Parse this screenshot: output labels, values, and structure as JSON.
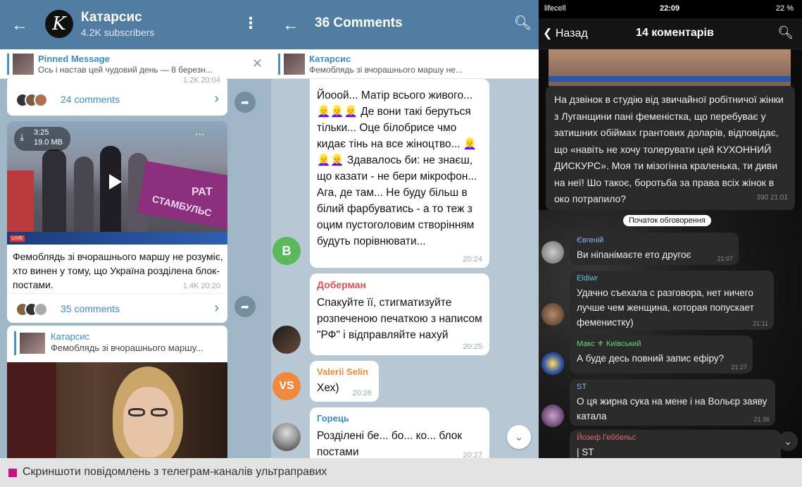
{
  "channel_panel": {
    "back_icon": "arrow-left-icon",
    "avatar_letter": "K",
    "channel_name": "Катарсис",
    "subscribers": "4.2K subscribers",
    "menu_icon": "vertical-dots-icon",
    "pinned": {
      "title": "Pinned Message",
      "text": "Ось і настав цей чудовий день — 8 березн..."
    },
    "post1": {
      "views_time": "1.2K 20:04",
      "comments_label": "24 comments"
    },
    "post2": {
      "video_length": "3:25",
      "video_size": "19.0 MB",
      "live_label": "LIVE",
      "banner_text_1": "РАТ",
      "banner_text_2": "СТАМБУЛЬС",
      "text": "Фемоблядь зі вчорашнього маршу не розуміє, хто винен у тому, що Україна розділена блок-постами.",
      "views_time": "1.4K 20:20",
      "comments_label": "35 comments"
    },
    "post3": {
      "forward_name": "Катарсис",
      "forward_text": "Фемоблядь зі вчорашнього маршу..."
    }
  },
  "comments_panel": {
    "title": "36 Comments",
    "pinned": {
      "name": "Катарсис",
      "text": "Фемоблядь зі вчорашнього маршу не..."
    },
    "messages": [
      {
        "author": "",
        "avatar_letter": "В",
        "avatar_color": "#5cb85c",
        "text": "Йооой... Матір всього живого... 👱‍♀️👱‍♀️👱‍♀️ Де вони такі беруться тільки... Оце білобрисе чмо кидає тінь на все жіноцтво... 👱‍♀️👱‍♀️👱‍♀️ Здавалось би: не знаєш, що казати - не бери мікрофон... Ага, де там... Не буду більш в білий фарбуватись - а то теж з оцим пустоголовим створінням будуть порівнювати...",
        "time": "20:24"
      },
      {
        "author": "Доберман",
        "author_color": "#d9534f",
        "text": "Спакуйте її, стигматизуйте розпеченою печаткою з написом \"РФ\" і відправляйте нахуй",
        "time": "20:25"
      },
      {
        "author": "Valerii Selin",
        "author_color": "#f0883e",
        "avatar_letter": "VS",
        "avatar_color": "#f0883e",
        "text": "Хех)",
        "time": "20:26"
      },
      {
        "author": "Горець",
        "author_color": "#3a8bc7",
        "text": "Розділені бе... бо... ко... блок постами",
        "time": "20:27"
      }
    ]
  },
  "dark_panel": {
    "status": {
      "carrier": "lifecell",
      "time": "22:09",
      "battery": "22 %"
    },
    "back_label": "Назад",
    "title": "14 коментарів",
    "main_text": "На дзвінок в студію від звичайної робітничої жінки з Луганщини пані феменістка, що перебуває у затишних обіймах грантових доларів, відповідає, що «навіть не хочу толерувати цей КУХОННИЙ ДИСКУРС». Моя ти мізогінна краленька, ти диви на неї! Шо такоє, боротьба за права всіх жінок в око потрапило?",
    "main_views_time": "390 21:01",
    "divider_label": "Початок обговорення",
    "messages": [
      {
        "author": "Євгеній",
        "author_color": "#8ab4f8",
        "text": "Ви нiпанiмаєте ето другоє",
        "time": "21:07"
      },
      {
        "author": "Eldiwr",
        "author_color": "#5ec4d6",
        "text": "Удачно съехала с разговора, нет ничего лучше чем женщина, которая попускает феменистку)",
        "time": "21:11"
      },
      {
        "author": "Макс ⚜ Київський",
        "author_color": "#6cd67a",
        "text": "А буде десь повний запис ефіру?",
        "time": "21:27"
      },
      {
        "author": "ST",
        "author_color": "#8ab4f8",
        "text": "О ця жирна сука на мене і на Вольєр заяву катала",
        "time": "21:36"
      },
      {
        "author": "Йозеф Геббельс",
        "author_color": "#e06c6c",
        "text": "| ST",
        "time": ""
      }
    ]
  },
  "caption": {
    "text": "Скриншоти повідомлень з телеграм-каналів ультраправих",
    "square_color": "#c2147f"
  }
}
